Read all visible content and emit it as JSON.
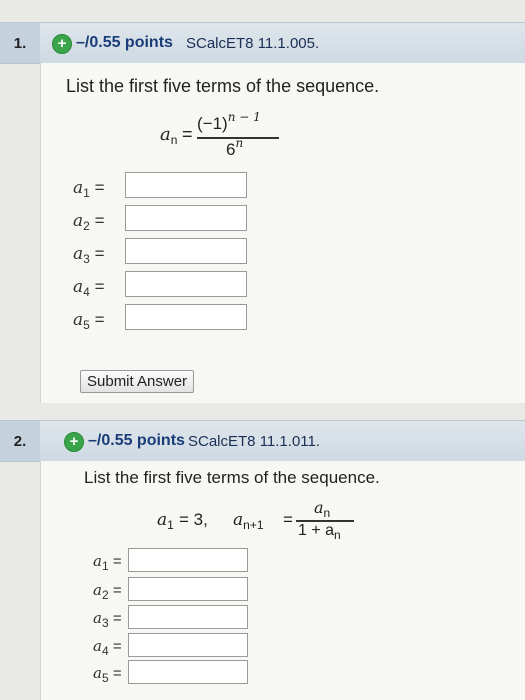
{
  "q1": {
    "number": "1.",
    "points": "–/0.55 points",
    "source": "SCalcET8 11.1.005.",
    "prompt": "List the first five terms of the sequence.",
    "formula": {
      "lhs": "a",
      "lhs_sub": "n",
      "eq": "=",
      "num_base": "(−1)",
      "num_exp": "n − 1",
      "den_base": "6",
      "den_exp": "n"
    },
    "terms": [
      {
        "name": "a",
        "sub": "1",
        "eq": "=",
        "value": ""
      },
      {
        "name": "a",
        "sub": "2",
        "eq": "=",
        "value": ""
      },
      {
        "name": "a",
        "sub": "3",
        "eq": "=",
        "value": ""
      },
      {
        "name": "a",
        "sub": "4",
        "eq": "=",
        "value": ""
      },
      {
        "name": "a",
        "sub": "5",
        "eq": "=",
        "value": ""
      }
    ],
    "submit_label": "Submit Answer"
  },
  "q2": {
    "number": "2.",
    "points": "–/0.55 points",
    "source": "SCalcET8 11.1.011.",
    "prompt": "List the first five terms of the sequence.",
    "formula": {
      "a1": "a",
      "a1_sub": "1",
      "a1_eq": "= 3,",
      "lhs": "a",
      "lhs_sub": "n+1",
      "eq": "=",
      "num": "a",
      "num_sub": "n",
      "den_pre": "1 + a",
      "den_sub": "n"
    },
    "terms": [
      {
        "name": "a",
        "sub": "1",
        "eq": "=",
        "value": ""
      },
      {
        "name": "a",
        "sub": "2",
        "eq": "=",
        "value": ""
      },
      {
        "name": "a",
        "sub": "3",
        "eq": "=",
        "value": ""
      },
      {
        "name": "a",
        "sub": "4",
        "eq": "=",
        "value": ""
      },
      {
        "name": "a",
        "sub": "5",
        "eq": "=",
        "value": ""
      }
    ]
  },
  "colors": {
    "plus": "#3aa44a",
    "points": "#1a3d7a",
    "header": "#cfd9e2"
  },
  "icons": {
    "status": "plus-circle-icon"
  }
}
